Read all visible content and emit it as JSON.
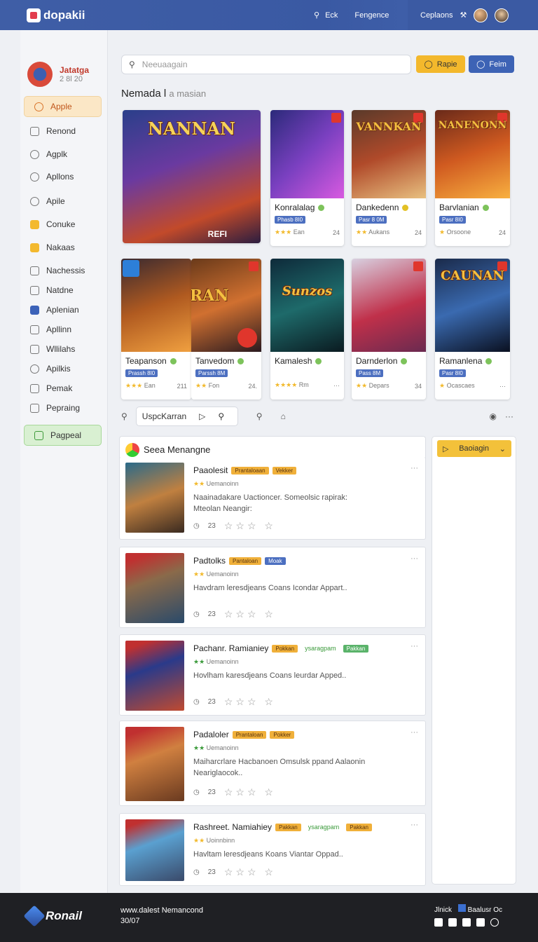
{
  "topbar": {
    "brand": "dopakii",
    "nav_search": "Eck",
    "nav_link": "Fengence",
    "account_label": "Ceplaons"
  },
  "sidebar": {
    "profile_name": "Jatatga",
    "profile_sub": "2 8l 20",
    "items": [
      {
        "label": "Apple",
        "icon": "user-icon"
      },
      {
        "label": "Renond",
        "icon": "home-icon"
      },
      {
        "label": "Agplk",
        "icon": "clock-icon"
      },
      {
        "label": "Apllons",
        "icon": "shield-icon"
      },
      {
        "label": "Apile",
        "icon": "circle-icon"
      },
      {
        "label": "Conuke",
        "icon": "doc-icon"
      },
      {
        "label": "Nakaas",
        "icon": "star-icon"
      },
      {
        "label": "Nachessis",
        "icon": "home-icon"
      },
      {
        "label": "Natdne",
        "icon": "checkbox-icon"
      },
      {
        "label": "Aplenian",
        "icon": "list-icon"
      },
      {
        "label": "Apllinn",
        "icon": "checkbox-icon"
      },
      {
        "label": "Wllilahs",
        "icon": "checkbox-icon"
      },
      {
        "label": "Apilkis",
        "icon": "circle-icon"
      },
      {
        "label": "Pemak",
        "icon": "triangle-icon"
      },
      {
        "label": "Pepraing",
        "icon": "home-icon"
      },
      {
        "label": "Pagpeal",
        "icon": "check-icon"
      }
    ]
  },
  "search": {
    "placeholder": "Neeuaagain",
    "apple_btn": "Rapie",
    "feim_btn": "Feim"
  },
  "section": {
    "title": "Nemada l",
    "title_muted": "a masian"
  },
  "featured": {
    "hero_title": "NANNAN",
    "hero_badge": "REFI",
    "cards_row1": [
      {
        "name": "Konralalag",
        "tag": "Phasb 8I0",
        "foot": "Ean",
        "count": "24",
        "img_title": ""
      },
      {
        "name": "Dankedenn",
        "tag": "Pasr 8 0M",
        "foot": "Aukans",
        "count": "24",
        "img_title": "VANNKAN"
      },
      {
        "name": "Barvlanian",
        "tag": "Pasr 8I0",
        "foot": "Orsoone",
        "count": "24",
        "img_title": "NANENONN"
      }
    ],
    "cards_row2": [
      {
        "name": "Teapanson",
        "tag": "Prassh 8I0",
        "foot": "Ean",
        "count": "211",
        "img_title": "SARRAN"
      },
      {
        "name": "Tanvedom",
        "tag": "Parssh 8M",
        "foot": "Fon",
        "count": "24.",
        "img_title": ""
      },
      {
        "name": "Kamalesh",
        "tag": "",
        "foot": "Rm",
        "count": "",
        "img_title": "Sunzos"
      },
      {
        "name": "Darnderlon",
        "tag": "Pass 8M",
        "foot": "Depars",
        "count": "34",
        "img_title": ""
      },
      {
        "name": "Ramanlena",
        "tag": "Pasr 8I0",
        "foot": "Ocascaes",
        "count": "",
        "img_title": "CAUNAN"
      }
    ]
  },
  "filter": {
    "input_value": "UspcKarran"
  },
  "list": {
    "header": "Seea Menangne",
    "rows": [
      {
        "title": "Paaolesit",
        "chips": [
          "Prantaloaan",
          "Vekker"
        ],
        "sub": "Uemanoinn",
        "desc": "Naainadakare Uactioncer. Someolsic rapirak: Mteolan Neangir:",
        "count": "23"
      },
      {
        "title": "Padtolks",
        "chips": [
          "Pantaloan",
          "Moak"
        ],
        "sub": "Uemanoinn",
        "desc": "Havdram leresdjeans Coans Icondar Appart..",
        "count": "23"
      },
      {
        "title": "Pachanr. Ramianiey",
        "chips": [
          "Pokkan",
          "ysaragpam",
          "Pakkan"
        ],
        "sub": "Uemanoinn",
        "desc": "Hovlham karesdjeans Coans leurdar Apped..",
        "count": "23"
      },
      {
        "title": "Padaloler",
        "chips": [
          "Prantaloan",
          "Pokker"
        ],
        "sub": "Uemanoinn",
        "desc": "Maiharcrlare Hacbanoen Omsulsk ppand Aalaonin Neariglaocok..",
        "count": "23"
      },
      {
        "title": "Rashreet. Namiahiey",
        "chips": [
          "Pakkan",
          "ysaragpam",
          "Pakkan"
        ],
        "sub": "Uoinnbinn",
        "desc": "Havltam leresdjeans Koans Viantar Oppad..",
        "count": "23"
      }
    ]
  },
  "right_panel": {
    "dropdown": "Baoiagin"
  },
  "footer": {
    "brand": "Ronail",
    "line1": "www.dalest Nemancond",
    "line2": "30/07",
    "right1": "Jlnick",
    "right2": "Baalusr Oc"
  }
}
